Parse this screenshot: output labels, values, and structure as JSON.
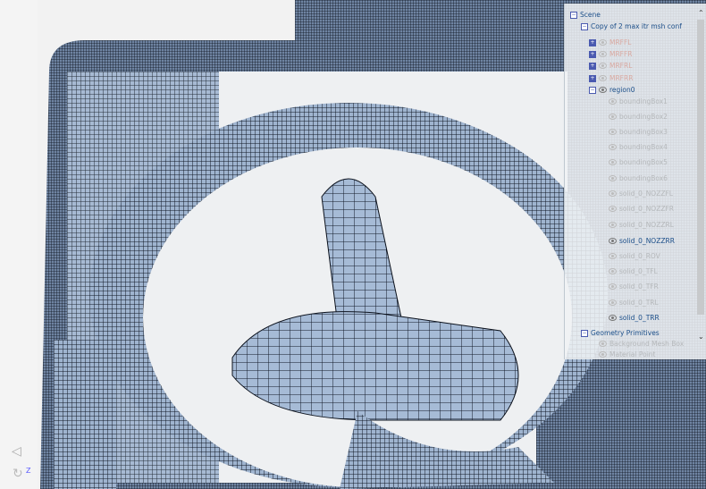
{
  "scene_tree": {
    "root": "Scene",
    "items": [
      {
        "label": "Copy of 2 max itr msh conf",
        "state": "on"
      },
      {
        "label": "MRFFL",
        "state": "red"
      },
      {
        "label": "MRFFR",
        "state": "red"
      },
      {
        "label": "MRFRL",
        "state": "red"
      },
      {
        "label": "MRFRR",
        "state": "red"
      },
      {
        "label": "region0",
        "state": "on"
      },
      {
        "label": "boundingBox1",
        "state": "off"
      },
      {
        "label": "boundingBox2",
        "state": "off"
      },
      {
        "label": "boundingBox3",
        "state": "off"
      },
      {
        "label": "boundingBox4",
        "state": "off"
      },
      {
        "label": "boundingBox5",
        "state": "off"
      },
      {
        "label": "boundingBox6",
        "state": "off"
      },
      {
        "label": "solid_0_NOZZFL",
        "state": "off"
      },
      {
        "label": "solid_0_NOZZFR",
        "state": "off"
      },
      {
        "label": "solid_0_NOZZRL",
        "state": "off"
      },
      {
        "label": "solid_0_NOZZRR",
        "state": "on"
      },
      {
        "label": "solid_0_ROV",
        "state": "off"
      },
      {
        "label": "solid_0_TFL",
        "state": "off"
      },
      {
        "label": "solid_0_TFR",
        "state": "off"
      },
      {
        "label": "solid_0_TRL",
        "state": "off"
      },
      {
        "label": "solid_0_TRR",
        "state": "on"
      },
      {
        "label": "Geometry Primitives",
        "state": "on"
      },
      {
        "label": "Background Mesh Box",
        "state": "off"
      },
      {
        "label": "Material Point",
        "state": "off"
      }
    ]
  },
  "axis": {
    "z_label": "Z"
  },
  "colors": {
    "mesh": "#a9bdd6",
    "edge": "#0d1420",
    "accent": "#1c4f8a"
  }
}
